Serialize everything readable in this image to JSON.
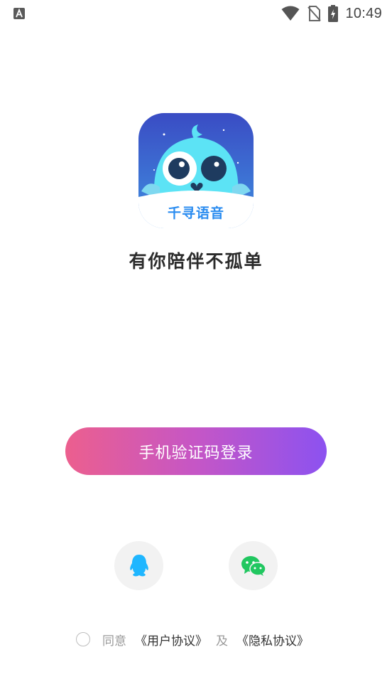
{
  "status_bar": {
    "time": "10:49",
    "left_icon": "accessibility-a-icon",
    "icons": [
      "wifi-icon",
      "no-sim-icon",
      "battery-charging-icon"
    ]
  },
  "app": {
    "logo_text": "千寻语音",
    "tagline": "有你陪伴不孤单"
  },
  "login": {
    "phone_button_label": "手机验证码登录",
    "social": [
      {
        "name": "qq",
        "icon": "qq-penguin-icon",
        "color": "#1fb6ff"
      },
      {
        "name": "wechat",
        "icon": "wechat-icon",
        "color": "#21c760"
      }
    ]
  },
  "agreement": {
    "agree_label": "同意",
    "user_agreement": "《用户协议》",
    "and_label": "及",
    "privacy_policy": "《隐私协议》"
  },
  "colors": {
    "button_gradient_start": "#ec5f8e",
    "button_gradient_end": "#8c52f0",
    "logo_bg_top": "#3b4fc8",
    "logo_bird": "#5ce3f5"
  }
}
